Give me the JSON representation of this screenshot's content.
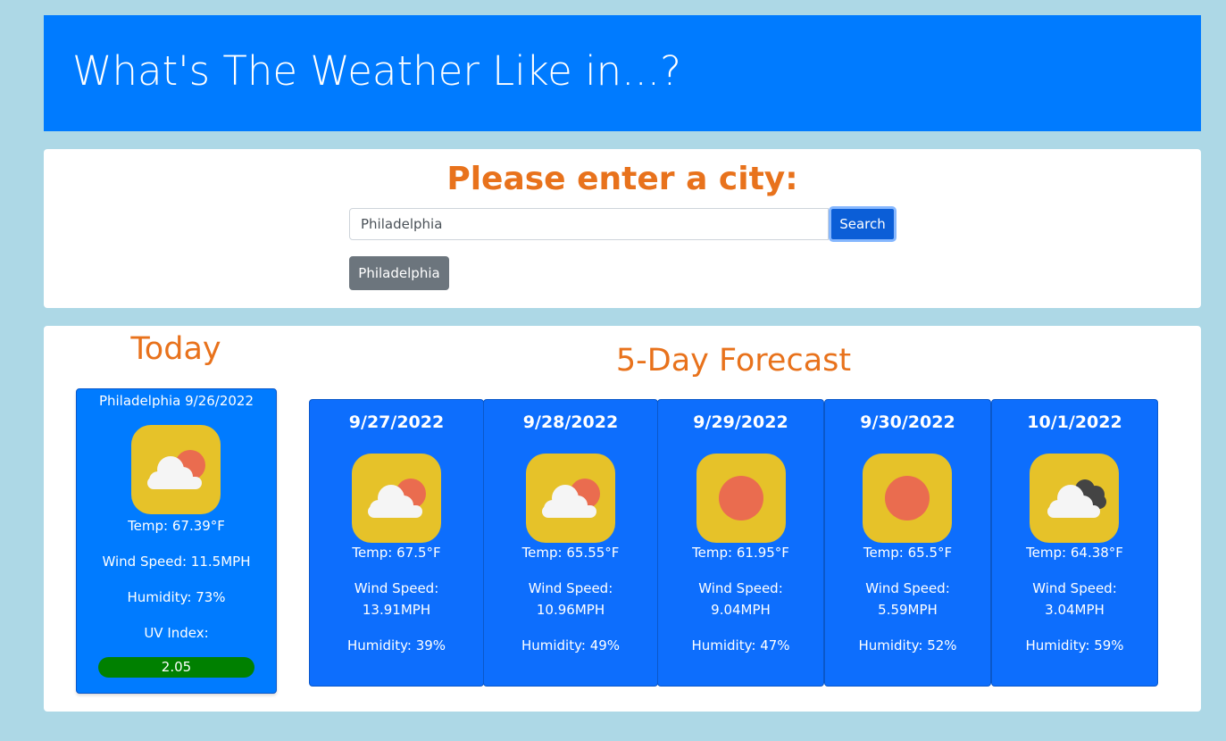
{
  "header": {
    "title": "What's The Weather Like in...?"
  },
  "search": {
    "prompt": "Please enter a city:",
    "input_value": "Philadelphia",
    "button_label": "Search",
    "history": [
      "Philadelphia"
    ]
  },
  "today": {
    "title": "Today",
    "city_date": "Philadelphia 9/26/2022",
    "icon": "partly-cloudy-icon",
    "temp": "Temp: 67.39°F",
    "wind": "Wind Speed: 11.5MPH",
    "humidity": "Humidity: 73%",
    "uv_label": "UV Index:",
    "uv_value": "2.05",
    "uv_color": "#008000"
  },
  "forecast": {
    "title": "5-Day Forecast",
    "days": [
      {
        "date": "9/27/2022",
        "icon": "partly-cloudy-icon",
        "temp": "Temp: 67.5°F",
        "wind_label": "Wind Speed:",
        "wind_value": "13.91MPH",
        "humidity": "Humidity: 39%"
      },
      {
        "date": "9/28/2022",
        "icon": "partly-cloudy-icon",
        "temp": "Temp: 65.55°F",
        "wind_label": "Wind Speed:",
        "wind_value": "10.96MPH",
        "humidity": "Humidity: 49%"
      },
      {
        "date": "9/29/2022",
        "icon": "sun-icon",
        "temp": "Temp: 61.95°F",
        "wind_label": "Wind Speed:",
        "wind_value": "9.04MPH",
        "humidity": "Humidity: 47%"
      },
      {
        "date": "9/30/2022",
        "icon": "sun-icon",
        "temp": "Temp: 65.5°F",
        "wind_label": "Wind Speed:",
        "wind_value": "5.59MPH",
        "humidity": "Humidity: 52%"
      },
      {
        "date": "10/1/2022",
        "icon": "cloudy-icon",
        "temp": "Temp: 64.38°F",
        "wind_label": "Wind Speed:",
        "wind_value": "3.04MPH",
        "humidity": "Humidity: 59%"
      }
    ]
  },
  "colors": {
    "page_bg": "#add8e6",
    "primary": "#007bff",
    "accent": "#e8721c",
    "icon_bg": "#e6c229",
    "sun": "#ea6c4f",
    "cloud": "#f5f5f5",
    "dark_cloud": "#444444"
  }
}
